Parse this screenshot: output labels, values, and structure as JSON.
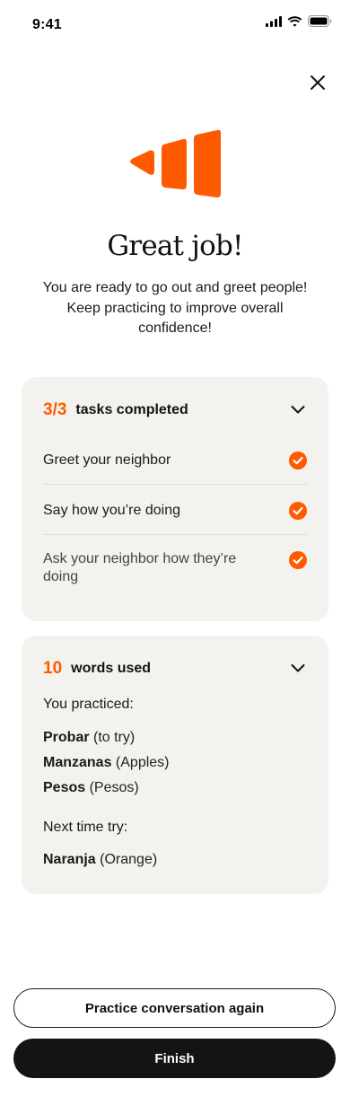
{
  "status_bar": {
    "time": "9:41",
    "icons": [
      "signal-icon",
      "wifi-icon",
      "battery-icon"
    ]
  },
  "header": {
    "close_icon": "close-icon"
  },
  "hero": {
    "title": "Great job!",
    "subtitle": "You are ready to go out and greet people! Keep practicing to improve overall confidence!"
  },
  "tasks_card": {
    "count": "3/3",
    "label": "tasks completed",
    "items": [
      {
        "label": "Greet your neighbor",
        "status": "completed"
      },
      {
        "label": "Say how you’re doing",
        "status": "completed"
      },
      {
        "label": "Ask your neighbor how they’re doing",
        "status": "completed"
      }
    ]
  },
  "words_card": {
    "count": "10",
    "label": "words used",
    "practiced_heading": "You practiced:",
    "practiced": [
      {
        "word": "Probar",
        "gloss": "(to try)"
      },
      {
        "word": "Manzanas",
        "gloss": "(Apples)"
      },
      {
        "word": "Pesos",
        "gloss": "(Pesos)"
      }
    ],
    "next_heading": "Next time try:",
    "next": [
      {
        "word": "Naranja",
        "gloss": "(Orange)"
      }
    ]
  },
  "actions": {
    "practice_again": "Practice conversation again",
    "finish": "Finish"
  },
  "colors": {
    "accent": "#ff5a00",
    "card_bg": "#f4f2ee",
    "primary_button": "#141414"
  }
}
